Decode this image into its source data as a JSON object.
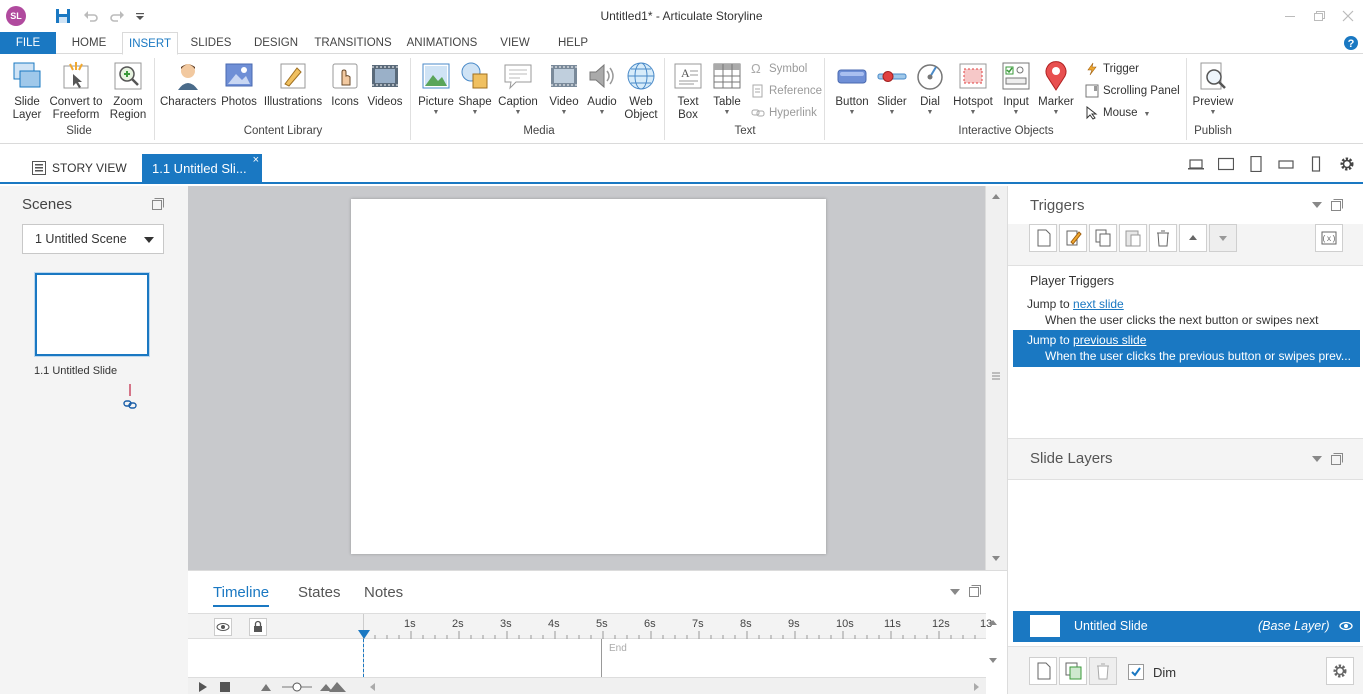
{
  "app": {
    "badge": "SL",
    "window_title": "Untitled1* - Articulate Storyline"
  },
  "ribbon_tabs": [
    "FILE",
    "HOME",
    "INSERT",
    "SLIDES",
    "DESIGN",
    "TRANSITIONS",
    "ANIMATIONS",
    "VIEW",
    "HELP"
  ],
  "active_tab": "INSERT",
  "ribbon": {
    "slide_group": {
      "label": "Slide",
      "slide_layer": "Slide\nLayer",
      "convert": "Convert to\nFreeform",
      "zoom": "Zoom\nRegion"
    },
    "content_library": {
      "label": "Content Library",
      "characters": "Characters",
      "photos": "Photos",
      "illustrations": "Illustrations",
      "icons": "Icons",
      "videos": "Videos"
    },
    "media": {
      "label": "Media",
      "picture": "Picture",
      "shape": "Shape",
      "caption": "Caption",
      "video": "Video",
      "audio": "Audio",
      "web_object": "Web\nObject"
    },
    "text": {
      "label": "Text",
      "text_box": "Text\nBox",
      "table": "Table",
      "symbol": "Symbol",
      "reference": "Reference",
      "hyperlink": "Hyperlink"
    },
    "interactive": {
      "label": "Interactive Objects",
      "button": "Button",
      "slider": "Slider",
      "dial": "Dial",
      "hotspot": "Hotspot",
      "input": "Input",
      "marker": "Marker",
      "trigger": "Trigger",
      "scrolling_panel": "Scrolling Panel",
      "mouse": "Mouse"
    },
    "publish": {
      "label": "Publish",
      "preview": "Preview"
    }
  },
  "doc_tabs": {
    "story_view": "STORY VIEW",
    "slide_tab": "1.1 Untitled Sli...",
    "close": "×"
  },
  "scenes": {
    "title": "Scenes",
    "selected_scene": "1 Untitled Scene",
    "slide_label": "1.1 Untitled Slide"
  },
  "timeline": {
    "tabs": [
      "Timeline",
      "States",
      "Notes"
    ],
    "active": "Timeline",
    "ticks": [
      "1s",
      "2s",
      "3s",
      "4s",
      "5s",
      "6s",
      "7s",
      "8s",
      "9s",
      "10s",
      "11s",
      "12s",
      "13"
    ],
    "end_label": "End"
  },
  "triggers": {
    "title": "Triggers",
    "section": "Player Triggers",
    "items": [
      {
        "action": "Jump to ",
        "target": "next slide",
        "condition": "When the user clicks the next button or swipes next",
        "selected": false
      },
      {
        "action": "Jump to ",
        "target": "previous slide",
        "condition": "When the user clicks the previous button or swipes prev...",
        "selected": true
      }
    ]
  },
  "layers": {
    "title": "Slide Layers",
    "base_name": "Untitled Slide",
    "base_tag": "(Base Layer)",
    "dim_label": "Dim",
    "dim_checked": true
  },
  "colors": {
    "accent": "#1a78c2",
    "badge": "#b04a9e"
  }
}
